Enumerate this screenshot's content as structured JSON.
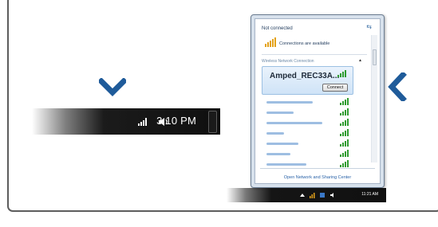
{
  "taskbar_closeup": {
    "clock": "3:10 PM",
    "icons": [
      "wifi-signal-icon",
      "speaker-icon"
    ]
  },
  "network_popup": {
    "status": "Not connected",
    "refresh_icon": "refresh-icon",
    "availability": "Connections are available",
    "section_title": "Wireless Network Connection",
    "selected_network": {
      "name": "Amped_REC33A...",
      "connect_label": "Connect"
    },
    "other_networks_count": 7,
    "footer_link": "Open Network and Sharing Center"
  },
  "taskbar_small": {
    "clock": "11:21 AM"
  },
  "colors": {
    "chevron": "#1f5b9a",
    "signal": "#2f9c2f",
    "taskbar": "#101010",
    "frame": "#5d5d5d"
  }
}
